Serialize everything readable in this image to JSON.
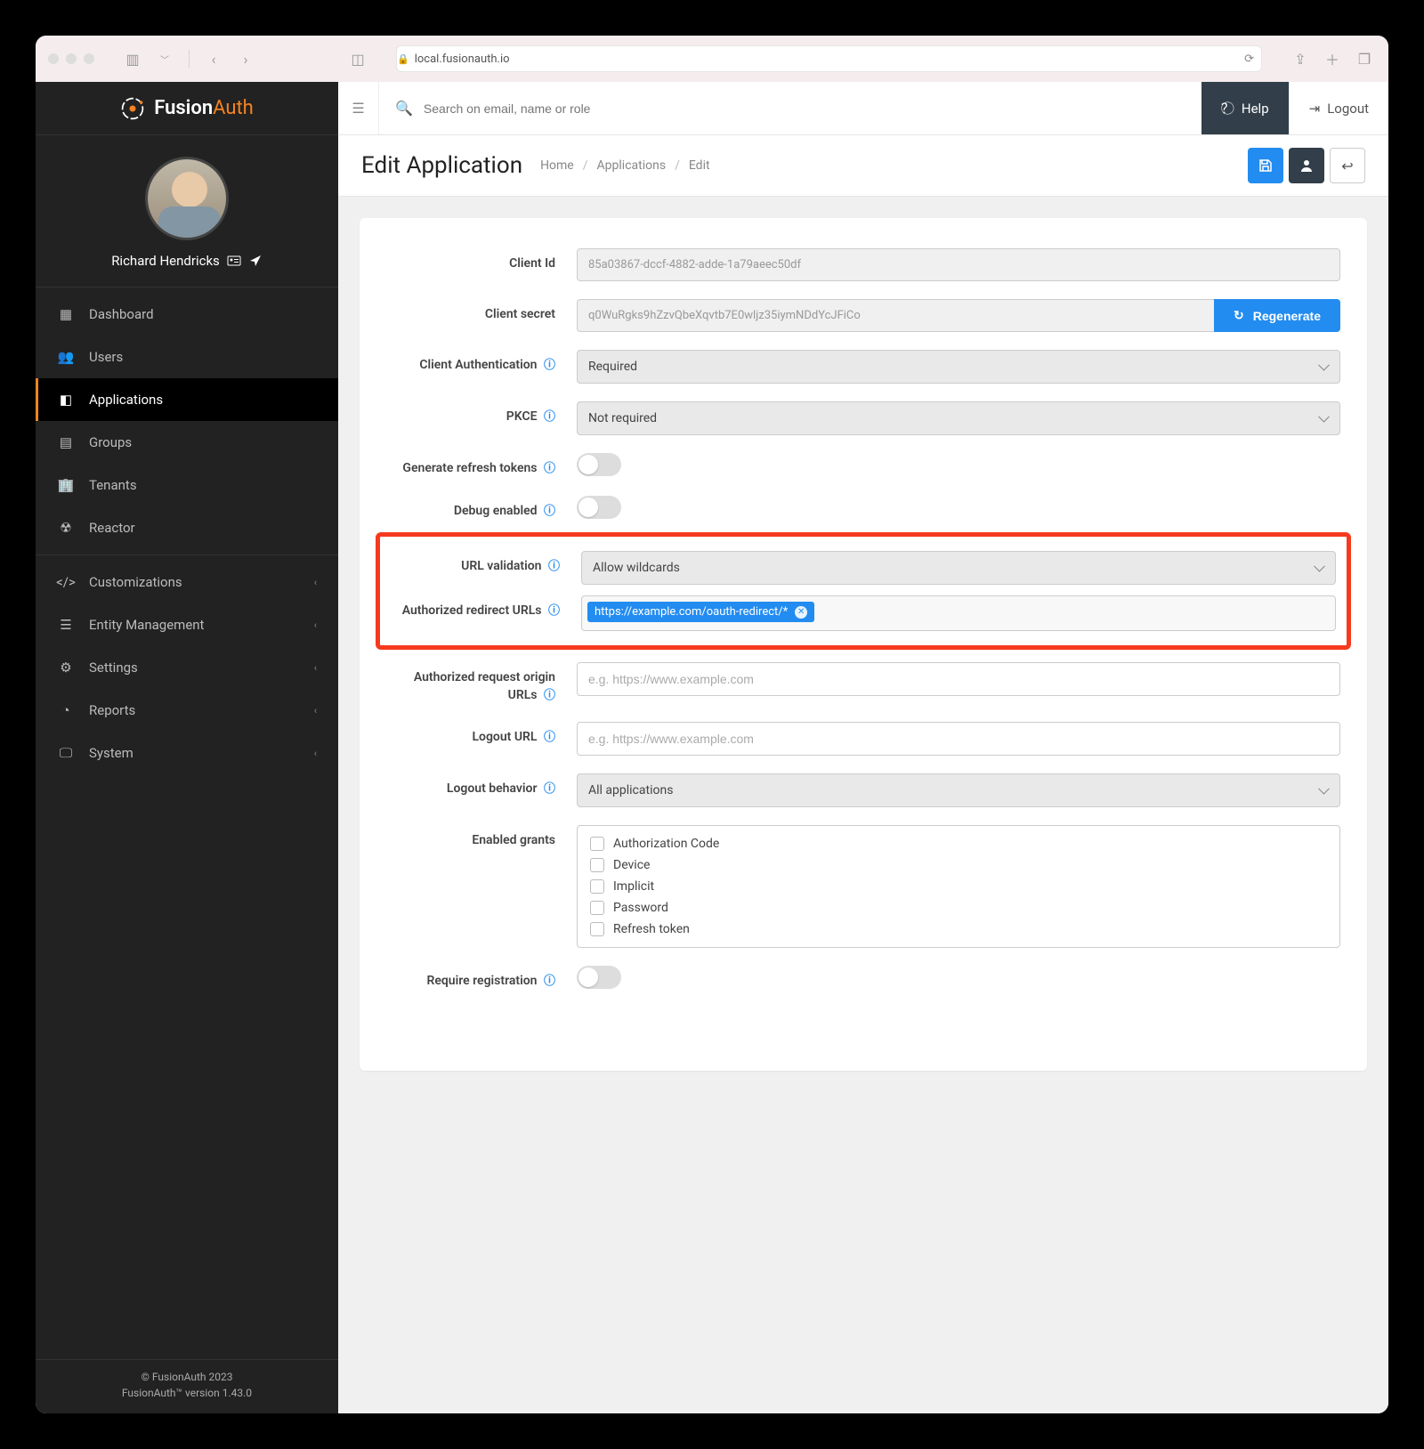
{
  "browser": {
    "url": "local.fusionauth.io"
  },
  "brand": {
    "name_a": "Fusion",
    "name_b": "Auth"
  },
  "profile": {
    "name": "Richard Hendricks"
  },
  "topbar": {
    "search_placeholder": "Search on email, name or role",
    "help": "Help",
    "logout": "Logout"
  },
  "page": {
    "title": "Edit Application",
    "crumb_home": "Home",
    "crumb_apps": "Applications",
    "crumb_edit": "Edit"
  },
  "nav": {
    "dashboard": "Dashboard",
    "users": "Users",
    "applications": "Applications",
    "groups": "Groups",
    "tenants": "Tenants",
    "reactor": "Reactor",
    "customizations": "Customizations",
    "entity_management": "Entity Management",
    "settings": "Settings",
    "reports": "Reports",
    "system": "System"
  },
  "form": {
    "client_id": {
      "label": "Client Id",
      "value": "85a03867-dccf-4882-adde-1a79aeec50df"
    },
    "client_secret": {
      "label": "Client secret",
      "value": "q0WuRgks9hZzvQbeXqvtb7E0wljz35iymNDdYcJFiCo",
      "button": "Regenerate"
    },
    "client_auth": {
      "label": "Client Authentication",
      "value": "Required"
    },
    "pkce": {
      "label": "PKCE",
      "value": "Not required"
    },
    "refresh_tokens": {
      "label": "Generate refresh tokens"
    },
    "debug": {
      "label": "Debug enabled"
    },
    "url_validation": {
      "label": "URL validation",
      "value": "Allow wildcards"
    },
    "redirect_urls": {
      "label": "Authorized redirect URLs",
      "tag": "https://example.com/oauth-redirect/*"
    },
    "origin_urls": {
      "label": "Authorized request origin URLs",
      "placeholder": "e.g. https://www.example.com"
    },
    "logout_url": {
      "label": "Logout URL",
      "placeholder": "e.g. https://www.example.com"
    },
    "logout_behavior": {
      "label": "Logout behavior",
      "value": "All applications"
    },
    "enabled_grants": {
      "label": "Enabled grants",
      "items": [
        "Authorization Code",
        "Device",
        "Implicit",
        "Password",
        "Refresh token"
      ]
    },
    "require_registration": {
      "label": "Require registration"
    }
  },
  "footer": {
    "line1": "© FusionAuth 2023",
    "line2": "FusionAuth™ version 1.43.0"
  }
}
